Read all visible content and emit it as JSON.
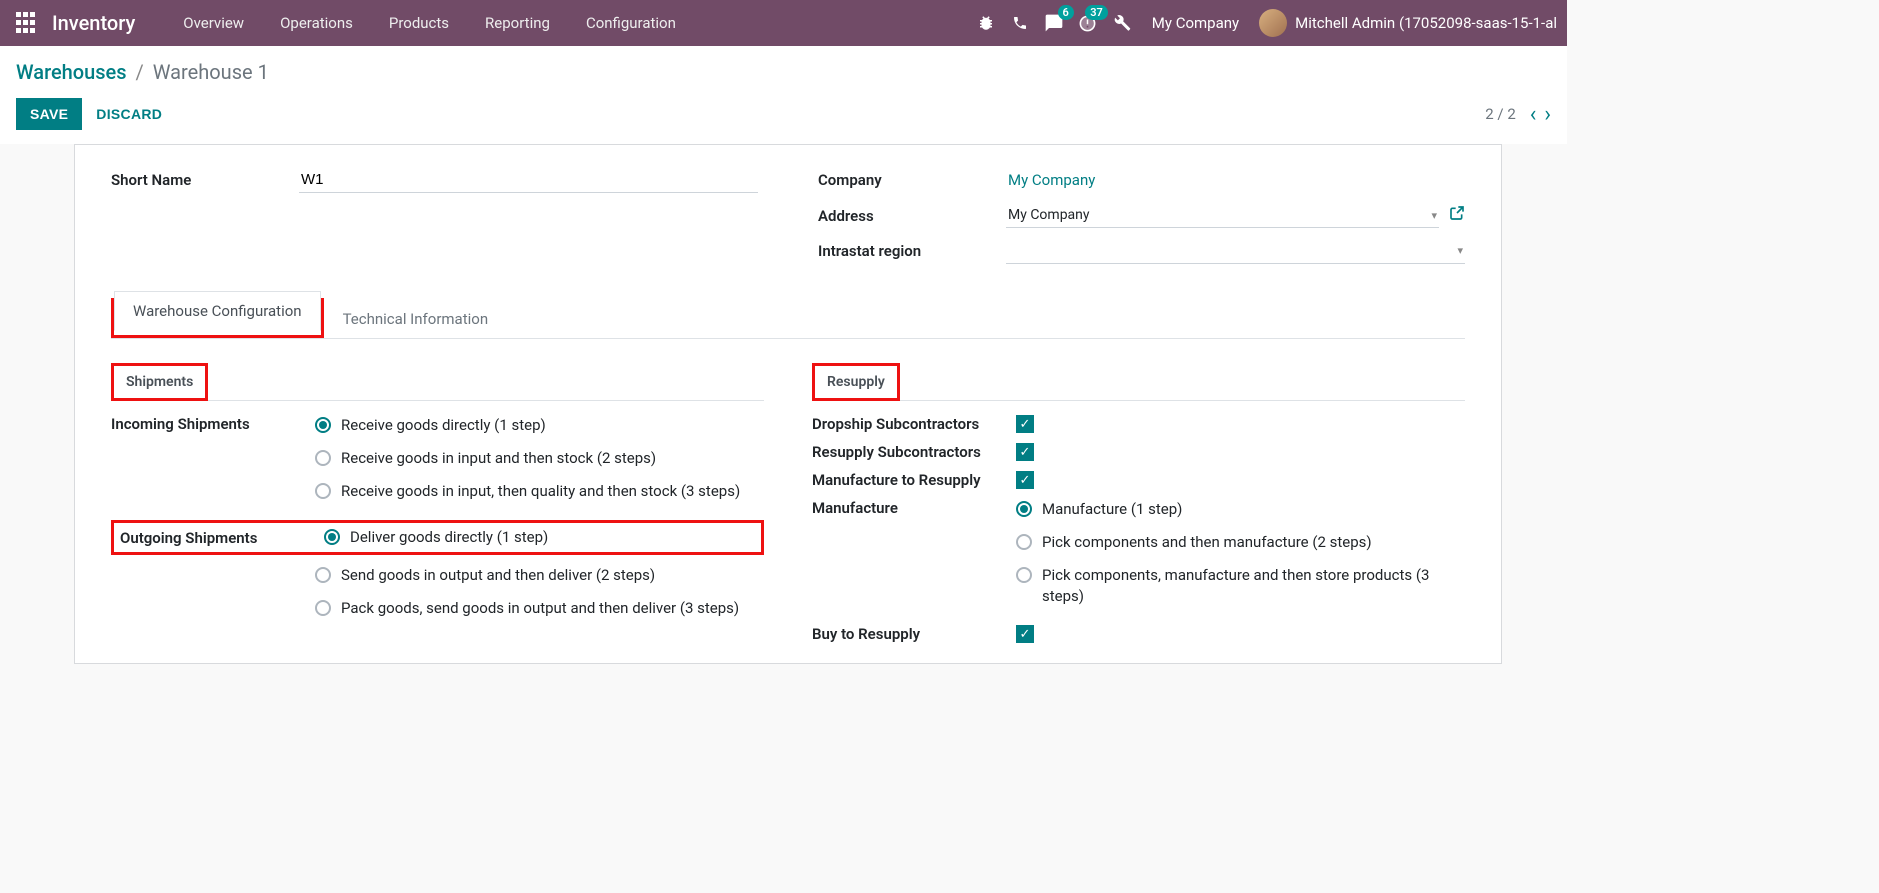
{
  "navbar": {
    "brand": "Inventory",
    "menu": [
      "Overview",
      "Operations",
      "Products",
      "Reporting",
      "Configuration"
    ],
    "msg_badge": "6",
    "activity_badge": "37",
    "company": "My Company",
    "user": "Mitchell Admin (17052098-saas-15-1-al"
  },
  "breadcrumb": {
    "root": "Warehouses",
    "current": "Warehouse 1"
  },
  "actions": {
    "save": "SAVE",
    "discard": "DISCARD",
    "pager": "2 / 2"
  },
  "fields": {
    "short_name_label": "Short Name",
    "short_name_value": "W1",
    "company_label": "Company",
    "company_value": "My Company",
    "address_label": "Address",
    "address_value": "My Company",
    "intrastat_label": "Intrastat region"
  },
  "tabs": {
    "config": "Warehouse Configuration",
    "tech": "Technical Information"
  },
  "shipments": {
    "title": "Shipments",
    "incoming_label": "Incoming Shipments",
    "incoming_opts": [
      "Receive goods directly (1 step)",
      "Receive goods in input and then stock (2 steps)",
      "Receive goods in input, then quality and then stock (3 steps)"
    ],
    "outgoing_label": "Outgoing Shipments",
    "outgoing_opts": [
      "Deliver goods directly (1 step)",
      "Send goods in output and then deliver (2 steps)",
      "Pack goods, send goods in output and then deliver (3 steps)"
    ]
  },
  "resupply": {
    "title": "Resupply",
    "dropship_label": "Dropship Subcontractors",
    "resupply_sub_label": "Resupply Subcontractors",
    "manuf_resupply_label": "Manufacture to Resupply",
    "manuf_label": "Manufacture",
    "manuf_opts": [
      "Manufacture (1 step)",
      "Pick components and then manufacture (2 steps)",
      "Pick components, manufacture and then store products (3 steps)"
    ],
    "buy_label": "Buy to Resupply"
  }
}
